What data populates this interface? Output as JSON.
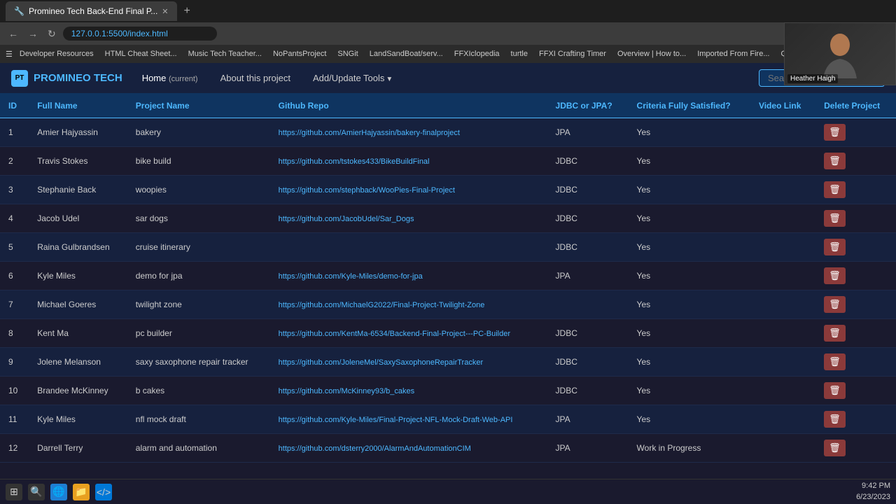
{
  "browser": {
    "tab_title": "Promineo Tech Back-End Final P...",
    "url": "127.0.0.1:5500/index.html",
    "bookmarks": [
      "Developer Resources",
      "HTML Cheat Sheet...",
      "Music Tech Teacher...",
      "NoPantsProject",
      "SNGit",
      "LandSandBoat/serv...",
      "FFXIclopedia",
      "turtle",
      "FFXI Crafting Timer",
      "Overview | How to...",
      "Imported From Fire...",
      "Quick Start Guide..."
    ]
  },
  "navbar": {
    "brand": "PROMINEO TECH",
    "brand_icon": "PT",
    "links": [
      {
        "label": "Home",
        "badge": "(current)",
        "active": true
      },
      {
        "label": "About this project",
        "active": false
      },
      {
        "label": "Add/Update Tools",
        "active": false,
        "dropdown": true
      }
    ],
    "search_placeholder": "Search Projects"
  },
  "table": {
    "headers": [
      "ID",
      "Full Name",
      "Project Name",
      "Github Repo",
      "JDBC or JPA?",
      "Criteria Fully Satisfied?",
      "Video Link",
      "Delete Project"
    ],
    "rows": [
      {
        "id": 1,
        "name": "Amier Hajyassin",
        "project": "bakery",
        "repo": "https://github.com/AmierHajyassin/bakery-finalproject",
        "jdbc_jpa": "JPA",
        "criteria": "Yes",
        "video": "",
        "delete": true
      },
      {
        "id": 2,
        "name": "Travis Stokes",
        "project": "bike build",
        "repo": "https://github.com/tstokes433/BikeBuildFinal",
        "jdbc_jpa": "JDBC",
        "criteria": "Yes",
        "video": "",
        "delete": true
      },
      {
        "id": 3,
        "name": "Stephanie Back",
        "project": "woopies",
        "repo": "https://github.com/stephback/WooPies-Final-Project",
        "jdbc_jpa": "JDBC",
        "criteria": "Yes",
        "video": "",
        "delete": true
      },
      {
        "id": 4,
        "name": "Jacob Udel",
        "project": "sar dogs",
        "repo": "https://github.com/JacobUdel/Sar_Dogs",
        "jdbc_jpa": "JDBC",
        "criteria": "Yes",
        "video": "",
        "delete": true
      },
      {
        "id": 5,
        "name": "Raina Gulbrandsen",
        "project": "cruise itinerary",
        "repo": "",
        "jdbc_jpa": "JDBC",
        "criteria": "Yes",
        "video": "",
        "delete": true
      },
      {
        "id": 6,
        "name": "Kyle Miles",
        "project": "demo for jpa",
        "repo": "https://github.com/Kyle-Miles/demo-for-jpa",
        "jdbc_jpa": "JPA",
        "criteria": "Yes",
        "video": "",
        "delete": true
      },
      {
        "id": 7,
        "name": "Michael Goeres",
        "project": "twilight zone",
        "repo": "https://github.com/MichaelG2022/Final-Project-Twilight-Zone",
        "jdbc_jpa": "",
        "criteria": "Yes",
        "video": "",
        "delete": true
      },
      {
        "id": 8,
        "name": "Kent Ma",
        "project": "pc builder",
        "repo": "https://github.com/KentMa-6534/Backend-Final-Project---PC-Builder",
        "jdbc_jpa": "JDBC",
        "criteria": "Yes",
        "video": "",
        "delete": true
      },
      {
        "id": 9,
        "name": "Jolene Melanson",
        "project": "saxy saxophone repair tracker",
        "repo": "https://github.com/JoleneMel/SaxySaxophoneRepairTracker",
        "jdbc_jpa": "JDBC",
        "criteria": "Yes",
        "video": "",
        "delete": true
      },
      {
        "id": 10,
        "name": "Brandee McKinney",
        "project": "b cakes",
        "repo": "https://github.com/McKinney93/b_cakes",
        "jdbc_jpa": "JDBC",
        "criteria": "Yes",
        "video": "",
        "delete": true
      },
      {
        "id": 11,
        "name": "Kyle Miles",
        "project": "nfl mock draft",
        "repo": "https://github.com/Kyle-Miles/Final-Project-NFL-Mock-Draft-Web-API",
        "jdbc_jpa": "JPA",
        "criteria": "Yes",
        "video": "",
        "delete": true
      },
      {
        "id": 12,
        "name": "Darrell Terry",
        "project": "alarm and automation",
        "repo": "https://github.com/dsterry2000/AlarmAndAutomationCIM",
        "jdbc_jpa": "JPA",
        "criteria": "Work in Progress",
        "video": "",
        "delete": true
      }
    ]
  },
  "webcam": {
    "person_name": "Heather Haigh"
  },
  "taskbar": {
    "time": "9:42 PM",
    "date": "6/23/2023"
  }
}
